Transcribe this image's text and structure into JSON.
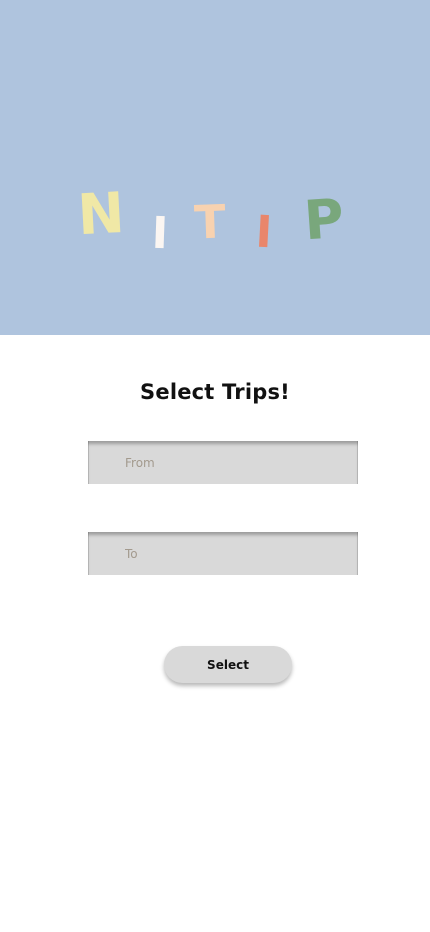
{
  "header": {
    "logo_text": "NITIP",
    "background_color": "#afc4de",
    "letter_colors": [
      "#f0e8a6",
      "#fbf6f2",
      "#f8d2b0",
      "#e9866b",
      "#79a77c"
    ]
  },
  "main": {
    "title": "Select Trips!",
    "from_field": {
      "placeholder": "From",
      "value": ""
    },
    "to_field": {
      "placeholder": "To",
      "value": ""
    },
    "select_button_label": "Select"
  }
}
